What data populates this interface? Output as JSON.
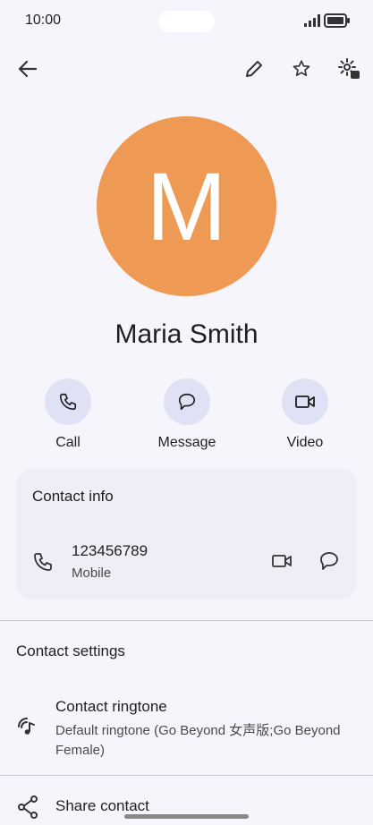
{
  "status": {
    "time": "10:00"
  },
  "toolbar": {
    "back": "arrow-back-icon",
    "edit": "pencil-icon",
    "favorite": "star-icon",
    "settings": "settings-icon"
  },
  "contact": {
    "initial": "M",
    "name": "Maria Smith",
    "avatar_color": "#ee9a55"
  },
  "actions": [
    {
      "label": "Call",
      "icon": "phone-icon"
    },
    {
      "label": "Message",
      "icon": "message-icon"
    },
    {
      "label": "Video",
      "icon": "video-icon"
    }
  ],
  "contact_info": {
    "title": "Contact info",
    "phone": {
      "number": "123456789",
      "type": "Mobile"
    }
  },
  "settings": {
    "title": "Contact settings",
    "ringtone": {
      "title": "Contact ringtone",
      "value": "Default ringtone (Go Beyond 女声版;Go Beyond Female)"
    },
    "share": {
      "title": "Share contact"
    }
  }
}
